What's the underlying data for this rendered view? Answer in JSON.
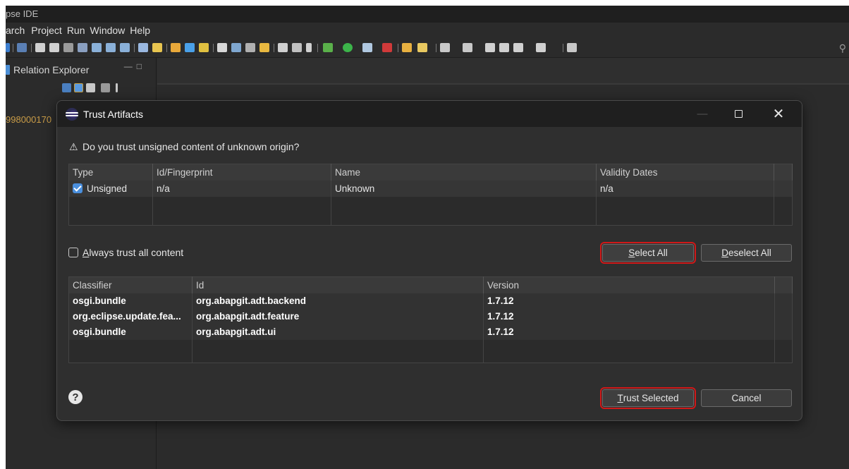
{
  "ide": {
    "title": "pse IDE",
    "menu": [
      "arch",
      "Project",
      "Run",
      "Window",
      "Help"
    ],
    "relation_explorer_label": "Relation Explorer",
    "tree_item": "998000170"
  },
  "dialog": {
    "title": "Trust Artifacts",
    "question": "Do you trust unsigned content of unknown origin?",
    "certificates": {
      "columns": [
        "Type",
        "Id/Fingerprint",
        "Name",
        "Validity Dates"
      ],
      "rows": [
        {
          "type": "Unsigned",
          "checked": true,
          "id": "n/a",
          "name": "Unknown",
          "validity": "n/a"
        }
      ]
    },
    "always_trust": {
      "prefix": "A",
      "rest": "lways trust all content",
      "checked": false
    },
    "select_all": {
      "prefix": "S",
      "rest": "elect All"
    },
    "deselect_all": {
      "prefix": "D",
      "rest": "eselect All"
    },
    "artifacts": {
      "columns": [
        "Classifier",
        "Id",
        "Version"
      ],
      "rows": [
        {
          "classifier": "osgi.bundle",
          "id": "org.abapgit.adt.backend",
          "version": "1.7.12"
        },
        {
          "classifier": "org.eclipse.update.fea...",
          "id": "org.abapgit.adt.feature",
          "version": "1.7.12"
        },
        {
          "classifier": "osgi.bundle",
          "id": "org.abapgit.adt.ui",
          "version": "1.7.12"
        }
      ]
    },
    "trust_selected": {
      "prefix": "T",
      "rest": "rust Selected"
    },
    "cancel": "Cancel"
  },
  "colors": {
    "highlight_border": "#d01818",
    "accent_checkbox": "#4a8fdd",
    "dialog_bg": "#2f2f2f",
    "titlebar_bg": "#1f1f1f"
  },
  "icons": [
    "warning-icon",
    "help-icon",
    "eclipse-logo-icon",
    "search-icon",
    "maximize-icon",
    "close-icon",
    "minimize-icon"
  ]
}
